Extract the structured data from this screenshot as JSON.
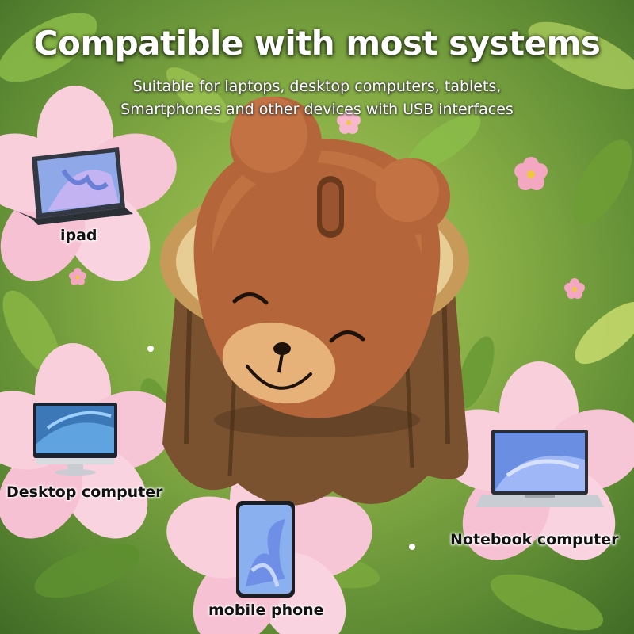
{
  "headline": "Compatible with most systems",
  "subtitle_line1": "Suitable for laptops, desktop computers, tablets,",
  "subtitle_line2": "Smartphones and other devices with USB interfaces",
  "devices": {
    "ipad": "ipad",
    "desktop": "Desktop computer",
    "notebook": "Notebook computer",
    "phone": "mobile phone"
  },
  "colors": {
    "mouse_body": "#b4663a",
    "mouse_muzzle": "#e7b27a",
    "petal_pink": "#f7c6d6",
    "leaf_green": "#7fae3e",
    "stump_wood": "#c79a5a"
  }
}
